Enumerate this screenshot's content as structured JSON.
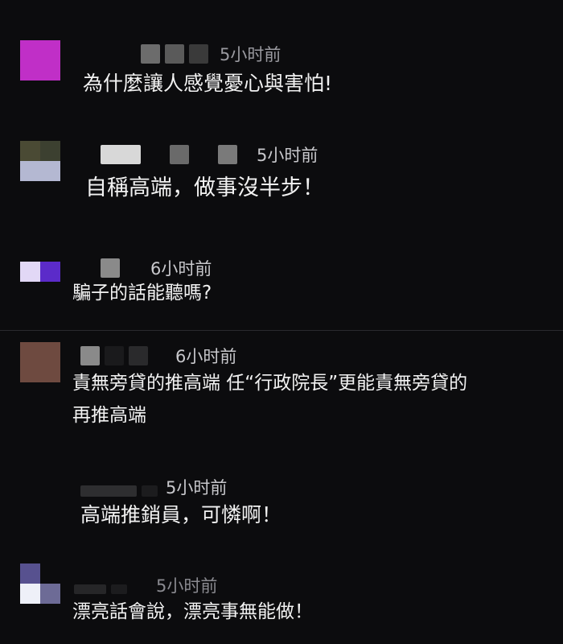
{
  "comments": [
    {
      "time": "5小时前",
      "text": "為什麼讓人感覺憂心與害怕!"
    },
    {
      "time": "5小时前",
      "text": "自稱高端，做事沒半步！"
    },
    {
      "time": "6小时前",
      "text": "騙子的話能聽嗎?"
    },
    {
      "time": "6小时前",
      "text_line1": "責無旁貸的推高端 任“行政院長”更能責無旁貸的",
      "text_line2": "再推高端"
    },
    {
      "time": "5小时前",
      "text": "高端推銷員，可憐啊！"
    },
    {
      "time": "5小时前",
      "text": "漂亮話會說，漂亮事無能做！"
    }
  ]
}
